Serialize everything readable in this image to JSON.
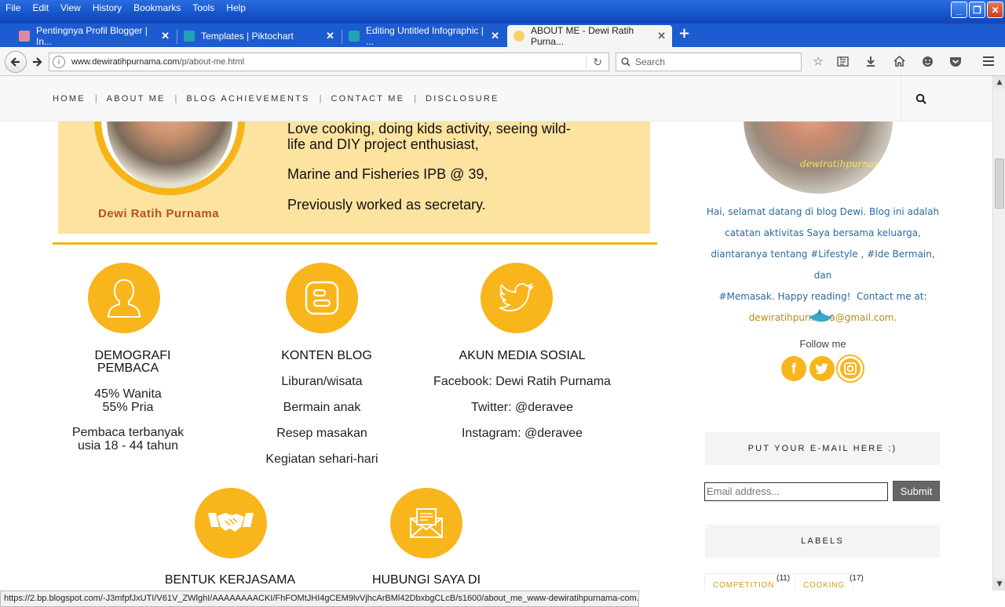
{
  "menu": [
    "File",
    "Edit",
    "View",
    "History",
    "Bookmarks",
    "Tools",
    "Help"
  ],
  "tabs": [
    {
      "title": "Pentingnya Profil Blogger | In...",
      "active": false
    },
    {
      "title": "Templates | Piktochart",
      "active": false
    },
    {
      "title": "Editing Untitled Infographic | ...",
      "active": false
    },
    {
      "title": "ABOUT ME - Dewi Ratih Purna...",
      "active": true
    }
  ],
  "url": {
    "domain": "www.dewiratihpurnama.com",
    "path": "/p/about-me.html"
  },
  "search_placeholder": "Search",
  "site_nav": [
    "HOME",
    "ABOUT ME",
    "BLOG ACHIEVEMENTS",
    "CONTACT ME",
    "DISCLOSURE"
  ],
  "banner": {
    "name": "Dewi Ratih Purnama",
    "line1a": "Love cooking, doing kids activity, seeing wild-",
    "line1b": "life and DIY project enthusiast,",
    "line2": "Marine and Fisheries IPB @ 39,",
    "line3": "Previously worked as secretary."
  },
  "infographic": {
    "demografi": {
      "title1": "DEMOGRAFI",
      "title2": "PEMBACA",
      "s1": "45%  Wanita",
      "s2": "55%  Pria",
      "s3a": "Pembaca terbanyak",
      "s3b": "usia 18 - 44 tahun"
    },
    "konten": {
      "title": "KONTEN BLOG",
      "items": [
        "Liburan/wisata",
        "Bermain anak",
        "Resep masakan",
        "Kegiatan sehari-hari"
      ]
    },
    "sosial": {
      "title": "AKUN MEDIA SOSIAL",
      "items": [
        "Facebook: Dewi Ratih Purnama",
        "Twitter: @deravee",
        "Instagram: @deravee"
      ]
    },
    "kerjasama": {
      "title": "BENTUK KERJASAMA"
    },
    "hubungi": {
      "title": "HUBUNGI SAYA DI"
    }
  },
  "sidebar": {
    "watermark": "dewiratihpurnama",
    "intro1": "Hai, selamat datang di blog Dewi. Blog ini adalah",
    "intro2": "catatan aktivitas Saya bersama keluarga,",
    "intro3": "diantaranya tentang #Lifestyle , #Ide Bermain, dan",
    "intro4": "#Memasak. Happy reading!",
    "contact": "Contact me at:",
    "email": "dewiratihpurnama@gmail.com.",
    "follow": "Follow me",
    "subscribe_title": "PUT YOUR E-MAIL HERE :)",
    "email_placeholder": "Email address...",
    "submit": "Submit",
    "labels_title": "LABELS",
    "labels": [
      {
        "name": "COMPETITION",
        "count": "(11)"
      },
      {
        "name": "COOKING",
        "count": "(17)"
      }
    ]
  },
  "status": "https://2.bp.blogspot.com/-J3mfpfJxUTI/V61V_ZWlghI/AAAAAAAACKI/FhFOMtJHI4gCEM9lvVjhcArBMl42DbxbgCLcB/s1600/about_me_www-dewiratihpurnama-com.png",
  "colors": {
    "accent": "#f9b51c",
    "banner": "#fde3a0",
    "link": "#2a6a9f"
  }
}
